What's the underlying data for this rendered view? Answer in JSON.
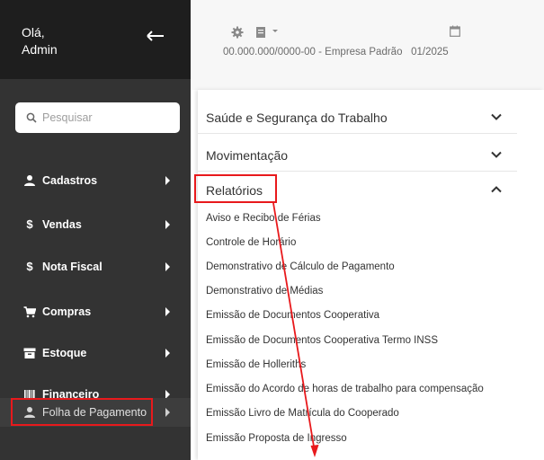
{
  "sidebar": {
    "greeting": "Olá,",
    "username": "Admin",
    "search_placeholder": "Pesquisar",
    "items": [
      {
        "label": "Cadastros",
        "icon": "person-icon"
      },
      {
        "label": "Vendas",
        "icon": "dollar-icon"
      },
      {
        "label": "Nota Fiscal",
        "icon": "dollar-icon"
      },
      {
        "label": "Compras",
        "icon": "cart-icon"
      },
      {
        "label": "Estoque",
        "icon": "archive-icon"
      },
      {
        "label": "Financeiro",
        "icon": "barcode-icon"
      },
      {
        "label": "Folha de Pagamento",
        "icon": "person-icon"
      }
    ]
  },
  "topbar": {
    "company": "00.000.000/0000-00 - Empresa Padrão",
    "period": "01/2025"
  },
  "panel": {
    "sections": [
      {
        "title": "Saúde e Segurança do Trabalho",
        "expanded": false
      },
      {
        "title": "Movimentação",
        "expanded": false
      },
      {
        "title": "Relatórios",
        "expanded": true
      }
    ],
    "reports": [
      "Aviso e Recibo de Férias",
      "Controle de Horário",
      "Demonstrativo de Cálculo de Pagamento",
      "Demonstrativo de Médias",
      "Emissão de Documentos Cooperativa",
      "Emissão de Documentos Cooperativa Termo INSS",
      "Emissão de Holleriths",
      "Emissão do Acordo de horas de trabalho para compensação",
      "Emissão Livro de Matrícula do Cooperado",
      "Emissão Proposta de Ingresso"
    ]
  },
  "colors": {
    "highlight": "#e8191c",
    "sidebar": "#333333"
  }
}
